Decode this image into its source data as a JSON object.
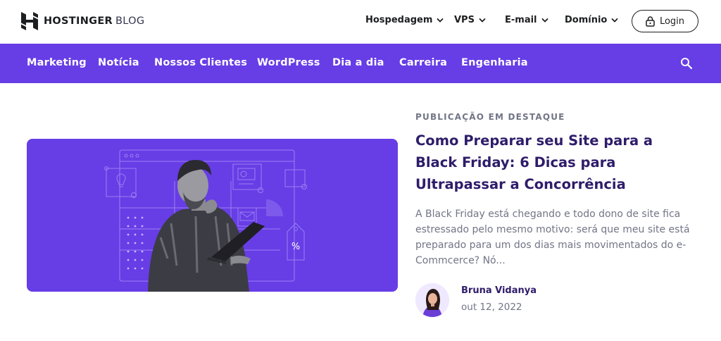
{
  "header": {
    "logo_brand": "HOSTINGER",
    "logo_suffix": "BLOG",
    "nav": [
      {
        "label": "Hospedagem"
      },
      {
        "label": "VPS"
      },
      {
        "label": "E-mail"
      },
      {
        "label": "Domínio"
      }
    ],
    "login_label": "Login"
  },
  "categories": [
    {
      "label": "Marketing"
    },
    {
      "label": "Notícia"
    },
    {
      "label": "Nossos Clientes"
    },
    {
      "label": "WordPress"
    },
    {
      "label": "Dia a dia"
    },
    {
      "label": "Carreira"
    },
    {
      "label": "Engenharia"
    }
  ],
  "featured": {
    "eyebrow": "PUBLICAÇÃO EM DESTAQUE",
    "title": "Como Preparar seu Site para a Black Friday: 6 Dicas para Ultrapassar a Concorrência",
    "excerpt": "A Black Friday está chegando e todo dono de site fica estressado pelo mesmo motivo: será que meu site está preparado para um dos dias mais movimentados do e-Commcerce?  Nó...",
    "author": "Bruna Vidanya",
    "date": "out 12, 2022",
    "image_percent_symbol": "%"
  },
  "colors": {
    "brand_purple": "#673de6",
    "title_purple": "#2f1c6a",
    "muted_text": "#727586",
    "text_dark": "#1d1e20"
  },
  "icons": [
    "hostinger-logo-icon",
    "chevron-down-icon",
    "lock-icon",
    "search-icon"
  ]
}
